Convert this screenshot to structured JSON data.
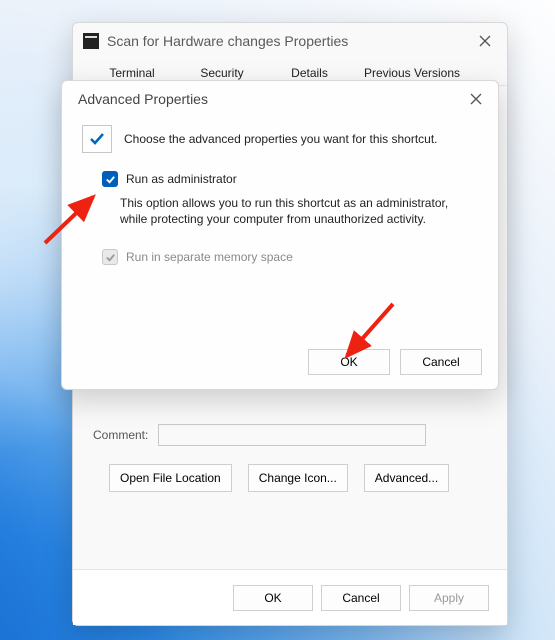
{
  "back_window": {
    "title": "Scan for Hardware changes Properties",
    "tabs": [
      "Terminal",
      "Security",
      "Details",
      "Previous Versions"
    ],
    "comment_label": "Comment:",
    "buttons": {
      "open_location": "Open File Location",
      "change_icon": "Change Icon...",
      "advanced": "Advanced..."
    },
    "footer": {
      "ok": "OK",
      "cancel": "Cancel",
      "apply": "Apply"
    }
  },
  "front_window": {
    "title": "Advanced Properties",
    "instruction": "Choose the advanced properties you want for this shortcut.",
    "run_admin": {
      "label": "Run as administrator",
      "checked": true,
      "description": "This option allows you to run this shortcut as an administrator, while protecting your computer from unauthorized activity."
    },
    "run_separate": {
      "label": "Run in separate memory space",
      "checked": true,
      "enabled": false
    },
    "footer": {
      "ok": "OK",
      "cancel": "Cancel"
    }
  }
}
